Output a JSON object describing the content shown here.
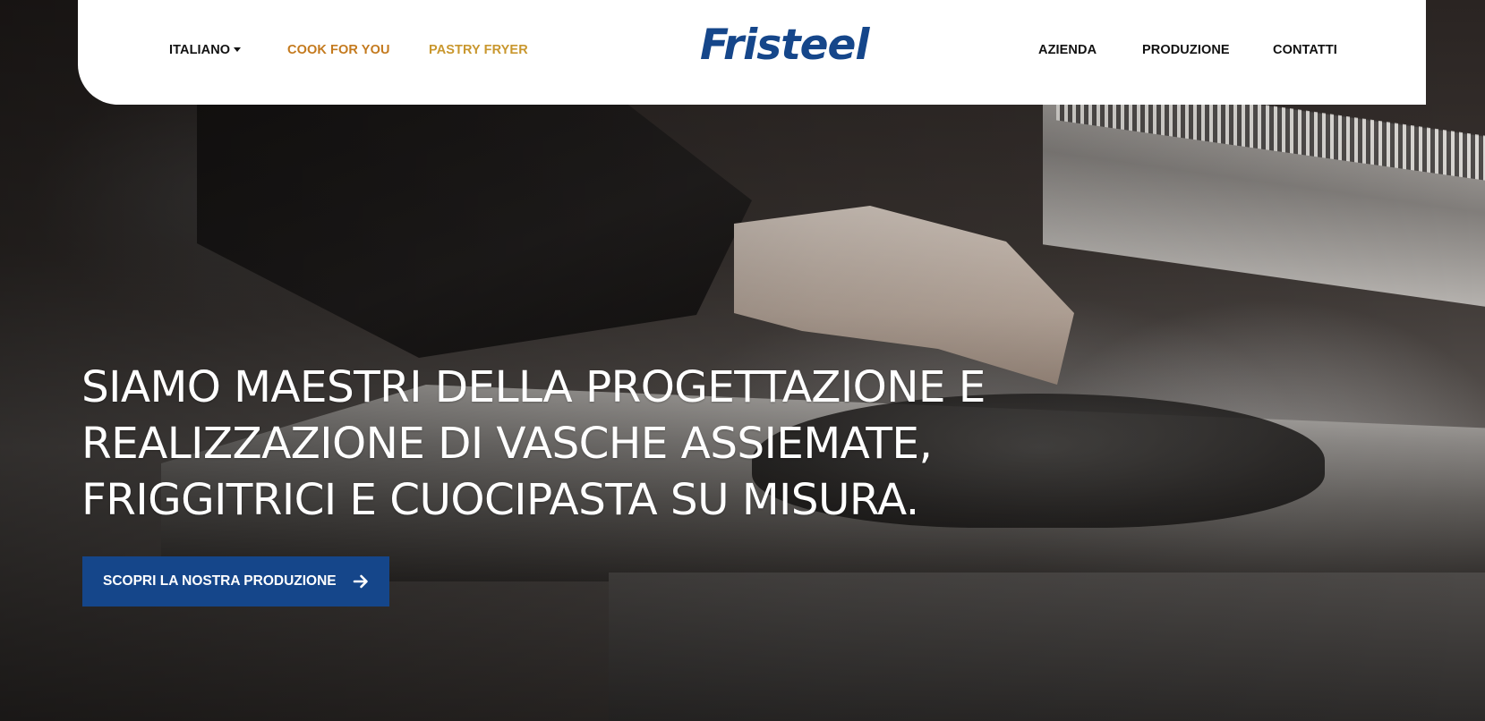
{
  "colors": {
    "brand_blue": "#15468a",
    "accent_orange": "#c47a1e",
    "accent_gold": "#c9972e",
    "text_dark": "#111111"
  },
  "header": {
    "language": "ITALIANO",
    "left_links": [
      "COOK FOR YOU",
      "PASTRY FRYER"
    ],
    "logo_text": "Fristeel",
    "right_links": [
      "AZIENDA",
      "PRODUZIONE",
      "CONTATTI"
    ]
  },
  "hero": {
    "headline_lines": [
      "SIAMO MAESTRI DELLA PROGETTAZIONE E",
      "REALIZZAZIONE DI VASCHE ASSIEMATE,",
      "FRIGGITRICI E CUOCIPASTA SU MISURA."
    ],
    "cta_label": "SCOPRI LA NOSTRA PRODUZIONE",
    "cta_icon": "arrow-right-icon",
    "background_image": "chef-hand-on-stainless-steel-fryer"
  }
}
